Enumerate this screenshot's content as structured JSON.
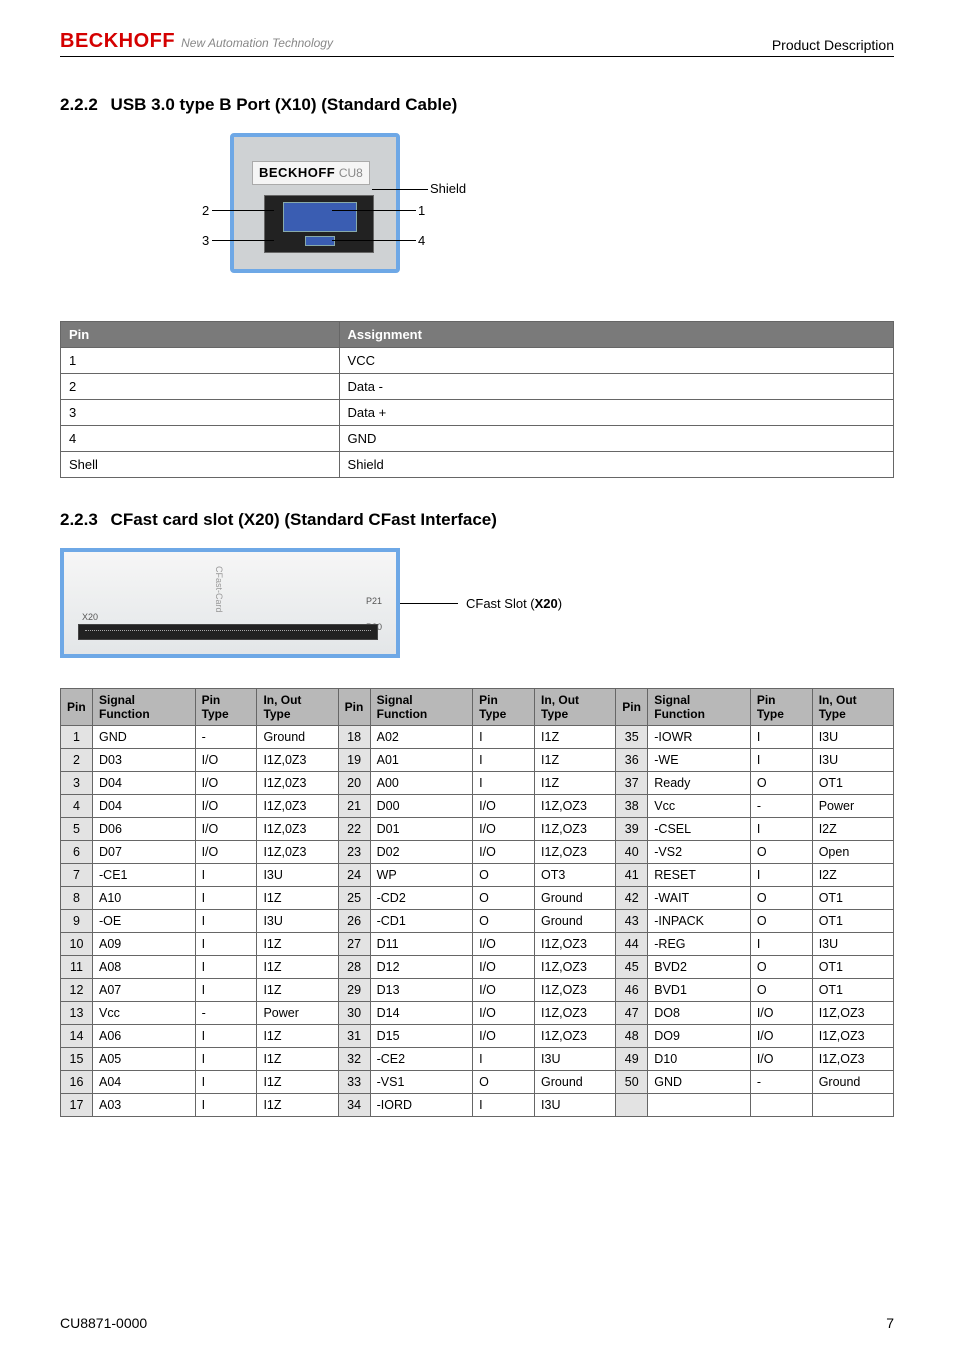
{
  "header": {
    "logo": "BECKHOFF",
    "tagline": "New Automation Technology",
    "right": "Product Description"
  },
  "sections": {
    "usb": {
      "num": "2.2.2",
      "title": "USB 3.0 type B Port (X10) (Standard Cable)",
      "fig": {
        "labels": {
          "shield": "Shield",
          "l1": "1",
          "l2": "2",
          "l3": "3",
          "l4": "4"
        },
        "devLabel": "BECKHOFF",
        "devModel": "CU8"
      },
      "table": {
        "headers": [
          "Pin",
          "Assignment"
        ],
        "rows": [
          [
            "1",
            "VCC"
          ],
          [
            "2",
            "Data -"
          ],
          [
            "3",
            "Data +"
          ],
          [
            "4",
            "GND"
          ],
          [
            "Shell",
            "Shield"
          ]
        ]
      }
    },
    "cfast": {
      "num": "2.2.3",
      "title": "CFast card slot (X20) (Standard CFast Interface)",
      "fig": {
        "slotLabel": "CFast Slot (",
        "slotBold": "X20",
        "slotClose": ")",
        "x20": "X20",
        "card": "CFast-Card",
        "p21": "P21",
        "p20": "P20"
      },
      "table": {
        "headers": [
          "Pin",
          "Signal Function",
          "Pin Type",
          "In, Out Type"
        ],
        "rows": [
          [
            [
              "1",
              "GND",
              "-",
              "Ground"
            ],
            [
              "18",
              "A02",
              "I",
              "I1Z"
            ],
            [
              "35",
              "-IOWR",
              "I",
              "I3U"
            ]
          ],
          [
            [
              "2",
              "D03",
              "I/O",
              "I1Z,0Z3"
            ],
            [
              "19",
              "A01",
              "I",
              "I1Z"
            ],
            [
              "36",
              "-WE",
              "I",
              "I3U"
            ]
          ],
          [
            [
              "3",
              "D04",
              "I/O",
              "I1Z,0Z3"
            ],
            [
              "20",
              "A00",
              "I",
              "I1Z"
            ],
            [
              "37",
              "Ready",
              "O",
              "OT1"
            ]
          ],
          [
            [
              "4",
              "D04",
              "I/O",
              "I1Z,0Z3"
            ],
            [
              "21",
              "D00",
              "I/O",
              "I1Z,OZ3"
            ],
            [
              "38",
              "Vcc",
              "-",
              "Power"
            ]
          ],
          [
            [
              "5",
              "D06",
              "I/O",
              "I1Z,0Z3"
            ],
            [
              "22",
              "D01",
              "I/O",
              "I1Z,OZ3"
            ],
            [
              "39",
              "-CSEL",
              "I",
              "I2Z"
            ]
          ],
          [
            [
              "6",
              "D07",
              "I/O",
              "I1Z,0Z3"
            ],
            [
              "23",
              "D02",
              "I/O",
              "I1Z,OZ3"
            ],
            [
              "40",
              "-VS2",
              "O",
              "Open"
            ]
          ],
          [
            [
              "7",
              "-CE1",
              "I",
              "I3U"
            ],
            [
              "24",
              "WP",
              "O",
              "OT3"
            ],
            [
              "41",
              "RESET",
              "I",
              "I2Z"
            ]
          ],
          [
            [
              "8",
              "A10",
              "I",
              "I1Z"
            ],
            [
              "25",
              "-CD2",
              "O",
              "Ground"
            ],
            [
              "42",
              "-WAIT",
              "O",
              "OT1"
            ]
          ],
          [
            [
              "9",
              "-OE",
              "I",
              "I3U"
            ],
            [
              "26",
              "-CD1",
              "O",
              "Ground"
            ],
            [
              "43",
              "-INPACK",
              "O",
              "OT1"
            ]
          ],
          [
            [
              "10",
              "A09",
              "I",
              "I1Z"
            ],
            [
              "27",
              "D11",
              "I/O",
              "I1Z,OZ3"
            ],
            [
              "44",
              "-REG",
              "I",
              "I3U"
            ]
          ],
          [
            [
              "11",
              "A08",
              "I",
              "I1Z"
            ],
            [
              "28",
              "D12",
              "I/O",
              "I1Z,OZ3"
            ],
            [
              "45",
              "BVD2",
              "O",
              "OT1"
            ]
          ],
          [
            [
              "12",
              "A07",
              "I",
              "I1Z"
            ],
            [
              "29",
              "D13",
              "I/O",
              "I1Z,OZ3"
            ],
            [
              "46",
              "BVD1",
              "O",
              "OT1"
            ]
          ],
          [
            [
              "13",
              "Vcc",
              "-",
              "Power"
            ],
            [
              "30",
              "D14",
              "I/O",
              "I1Z,OZ3"
            ],
            [
              "47",
              "DO8",
              "I/O",
              "I1Z,OZ3"
            ]
          ],
          [
            [
              "14",
              "A06",
              "I",
              "I1Z"
            ],
            [
              "31",
              "D15",
              "I/O",
              "I1Z,OZ3"
            ],
            [
              "48",
              "DO9",
              "I/O",
              "I1Z,OZ3"
            ]
          ],
          [
            [
              "15",
              "A05",
              "I",
              "I1Z"
            ],
            [
              "32",
              "-CE2",
              "I",
              "I3U"
            ],
            [
              "49",
              "D10",
              "I/O",
              "I1Z,OZ3"
            ]
          ],
          [
            [
              "16",
              "A04",
              "I",
              "I1Z"
            ],
            [
              "33",
              "-VS1",
              "O",
              "Ground"
            ],
            [
              "50",
              "GND",
              "-",
              "Ground"
            ]
          ],
          [
            [
              "17",
              "A03",
              "I",
              "I1Z"
            ],
            [
              "34",
              "-IORD",
              "I",
              "I3U"
            ],
            [
              "",
              "",
              "",
              ""
            ]
          ]
        ]
      }
    }
  },
  "footer": {
    "left": "CU8871-0000",
    "right": "7"
  }
}
